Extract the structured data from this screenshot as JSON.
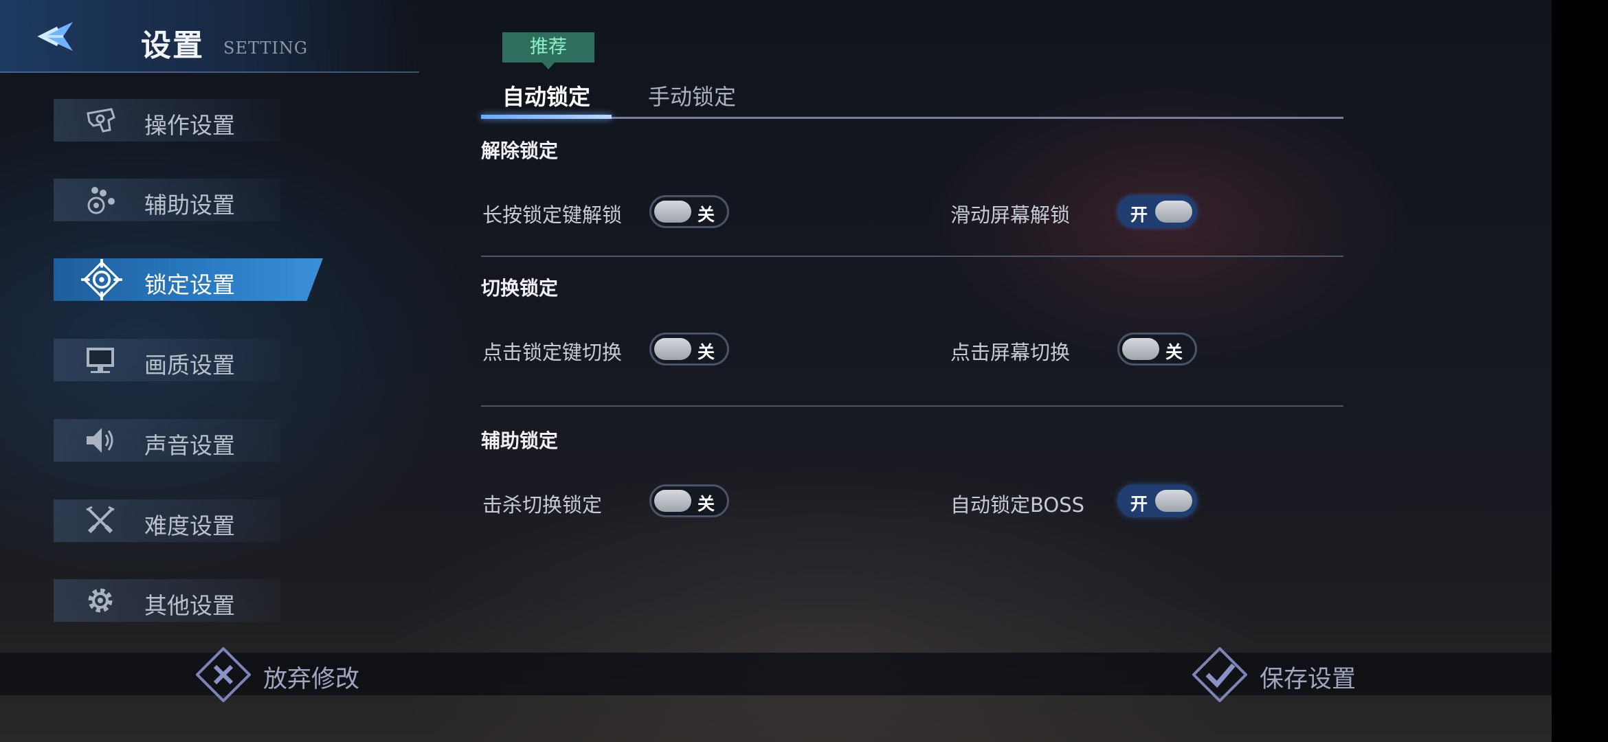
{
  "header": {
    "title": "设置",
    "subtitle": "SETTING"
  },
  "sidebar": {
    "items": [
      {
        "label": "操作设置",
        "icon": "controller-icon"
      },
      {
        "label": "辅助设置",
        "icon": "assist-dots-icon"
      },
      {
        "label": "锁定设置",
        "icon": "crosshair-icon",
        "active": true
      },
      {
        "label": "画质设置",
        "icon": "monitor-icon"
      },
      {
        "label": "声音设置",
        "icon": "speaker-icon"
      },
      {
        "label": "难度设置",
        "icon": "crossed-swords-icon"
      },
      {
        "label": "其他设置",
        "icon": "gear-icon"
      }
    ]
  },
  "tabs": {
    "badge": "推荐",
    "items": [
      {
        "label": "自动锁定",
        "active": true
      },
      {
        "label": "手动锁定",
        "active": false
      }
    ]
  },
  "sections": [
    {
      "title": "解除锁定",
      "options": [
        {
          "label": "长按锁定键解锁",
          "state": "关",
          "on": false
        },
        {
          "label": "滑动屏幕解锁",
          "state": "开",
          "on": true
        }
      ]
    },
    {
      "title": "切换锁定",
      "options": [
        {
          "label": "点击锁定键切换",
          "state": "关",
          "on": false
        },
        {
          "label": "点击屏幕切换",
          "state": "关",
          "on": false
        }
      ]
    },
    {
      "title": "辅助锁定",
      "options": [
        {
          "label": "击杀切换锁定",
          "state": "关",
          "on": false
        },
        {
          "label": "自动锁定BOSS",
          "state": "开",
          "on": true
        }
      ]
    }
  ],
  "footer": {
    "discard_label": "放弃修改",
    "save_label": "保存设置"
  },
  "colors": {
    "accent": "#2a7cc4",
    "toggle_on": "#1f3d70",
    "badge": "#2d6e5c"
  }
}
